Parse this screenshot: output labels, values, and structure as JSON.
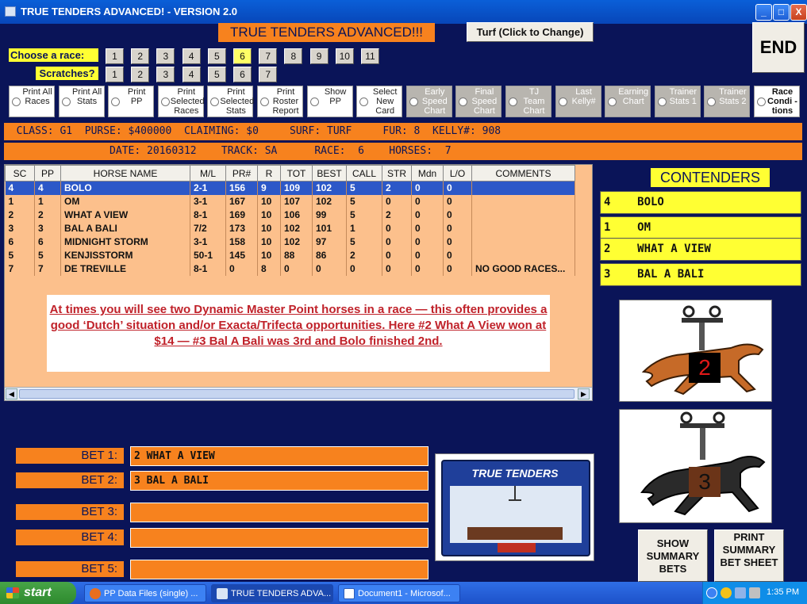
{
  "window": {
    "title": "TRUE TENDERS ADVANCED! - VERSION 2.0",
    "min": "_",
    "max": "□",
    "close": "X"
  },
  "header": {
    "app_title": "TRUE TENDERS ADVANCED!!!",
    "turf_button": "Turf (Click to Change)",
    "end_button": "END"
  },
  "race_selector": {
    "label": "Choose  a race:",
    "numbers": [
      "1",
      "2",
      "3",
      "4",
      "5",
      "6",
      "7",
      "8",
      "9",
      "10",
      "11"
    ],
    "selected": "6"
  },
  "scratches": {
    "label": "Scratches?",
    "numbers": [
      "1",
      "2",
      "3",
      "4",
      "5",
      "6",
      "7"
    ]
  },
  "options": [
    "Print All Races",
    "Print All Stats",
    "Print PP",
    "Print Selected Races",
    "Print Selected Stats",
    "Print Roster Report",
    "Show PP",
    "Select New Card",
    "Early Speed Chart",
    "Final Speed Chart",
    "TJ Team Chart",
    "Last Kelly#",
    "Earning Chart",
    "Trainer Stats 1",
    "Trainer Stats 2",
    "Race Condi -tions"
  ],
  "info": {
    "line1": "  CLASS: G1  PURSE: $400000  CLAIMING: $0     SURF: TURF     FUR: 8  KELLY#: 908",
    "line2": "                 DATE: 20160312    TRACK: SA      RACE:  6    HORSES:  7"
  },
  "grid": {
    "columns": [
      "SC",
      "PP",
      "HORSE NAME",
      "M/L",
      "PR#",
      "R",
      "TOT",
      "BEST",
      "CALL",
      "STR",
      "Mdn",
      "L/O",
      "COMMENTS"
    ],
    "rows": [
      [
        "4",
        "4",
        "BOLO",
        "2-1",
        "156",
        "9",
        "109",
        "102",
        "5",
        "2",
        "0",
        "0",
        ""
      ],
      [
        "1",
        "1",
        "OM",
        "3-1",
        "167",
        "10",
        "107",
        "102",
        "5",
        "0",
        "0",
        "0",
        ""
      ],
      [
        "2",
        "2",
        "WHAT A VIEW",
        "8-1",
        "169",
        "10",
        "106",
        "99",
        "5",
        "2",
        "0",
        "0",
        ""
      ],
      [
        "3",
        "3",
        "BAL A BALI",
        "7/2",
        "173",
        "10",
        "102",
        "101",
        "1",
        "0",
        "0",
        "0",
        ""
      ],
      [
        "6",
        "6",
        "MIDNIGHT STORM",
        "3-1",
        "158",
        "10",
        "102",
        "97",
        "5",
        "0",
        "0",
        "0",
        ""
      ],
      [
        "5",
        "5",
        "KENJISSTORM",
        "50-1",
        "145",
        "10",
        "88",
        "86",
        "2",
        "0",
        "0",
        "0",
        ""
      ],
      [
        "7",
        "7",
        "DE TREVILLE",
        "8-1",
        "0",
        "8",
        "0",
        "0",
        "0",
        "0",
        "0",
        "0",
        "NO GOOD RACES..."
      ]
    ]
  },
  "note": "At times you will see two Dynamic Master Point horses in a race — this often provides a good ‘Dutch’ situation and/or Exacta/Trifecta opportunities.  Here #2 What A View won at $14 — #3 Bal A Bali was 3rd and Bolo finished 2nd.",
  "contenders": {
    "title": "CONTENDERS",
    "items": [
      "4    BOLO",
      "1    OM",
      "2    WHAT A VIEW",
      "3    BAL A BALI"
    ]
  },
  "picks": {
    "first": "2",
    "second": "3"
  },
  "bets": [
    {
      "label": "BET 1:",
      "value": "2 WHAT A VIEW"
    },
    {
      "label": "BET 2:",
      "value": "3 BAL A BALI"
    },
    {
      "label": "BET 3:",
      "value": ""
    },
    {
      "label": "BET 4:",
      "value": ""
    },
    {
      "label": "BET 5:",
      "value": ""
    }
  ],
  "machine_logo": "TRUE TENDERS",
  "buttons": {
    "show_summary": "SHOW SUMMARY BETS",
    "print_summary": "PRINT SUMMARY BET SHEET"
  },
  "taskbar": {
    "start": "start",
    "tasks": [
      "PP Data Files (single) ...",
      "TRUE TENDERS ADVA...",
      "Document1 - Microsof..."
    ],
    "clock": "1:35 PM"
  },
  "colors": {
    "background": "#0a1458",
    "orange": "#f7821e",
    "yellow": "#ffff33",
    "grid": "#fcc08c",
    "selected_row": "#2c58c8"
  }
}
